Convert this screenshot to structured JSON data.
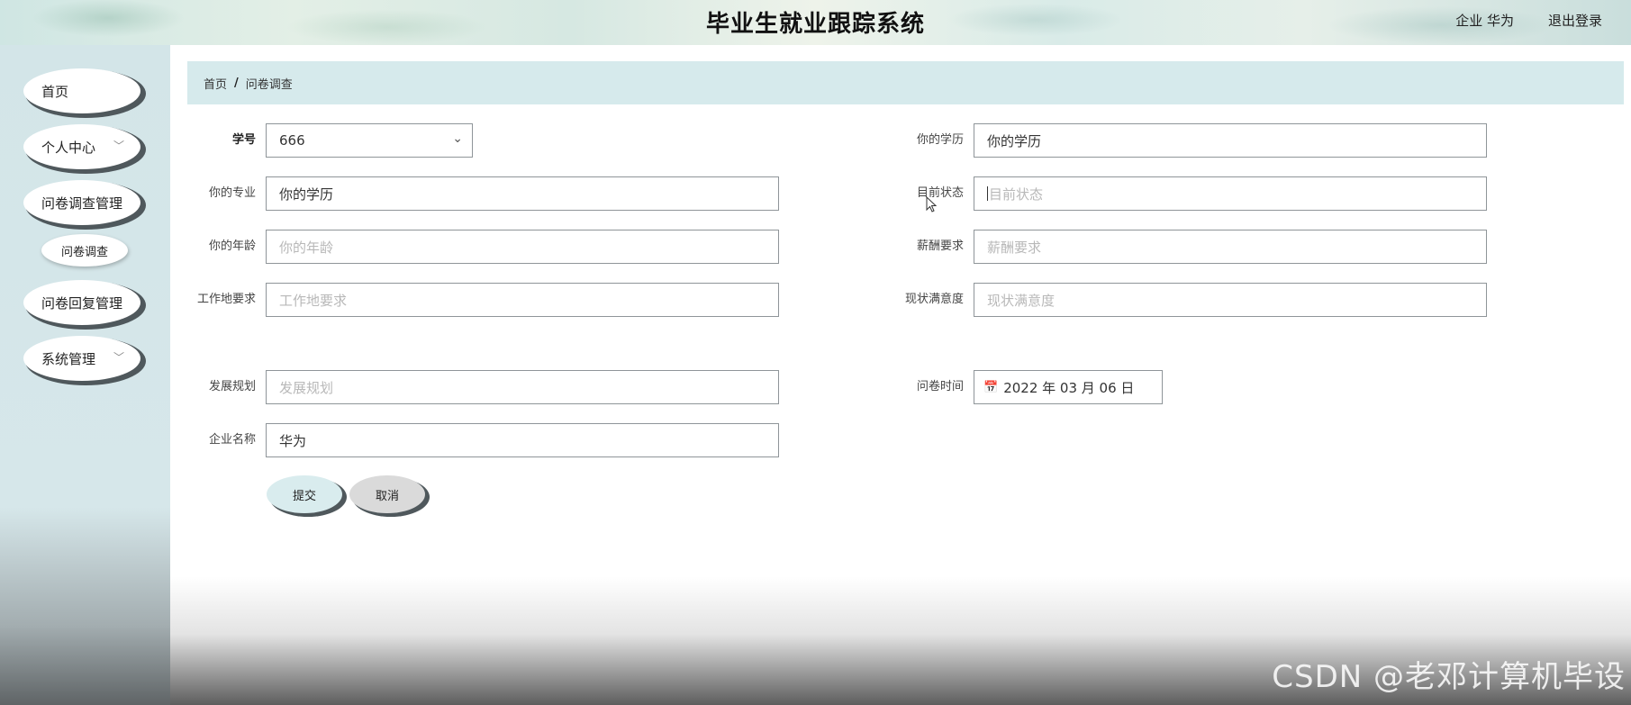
{
  "header": {
    "title": "毕业生就业跟踪系统",
    "user": "企业 华为",
    "logout": "退出登录"
  },
  "sidebar": {
    "items": [
      {
        "label": "首页"
      },
      {
        "label": "个人中心",
        "chevron": "﹀"
      },
      {
        "label": "问卷调查管理"
      },
      {
        "label": "问卷调查"
      },
      {
        "label": "问卷回复管理"
      },
      {
        "label": "系统管理",
        "chevron": "﹀"
      }
    ]
  },
  "breadcrumb": {
    "home": "首页",
    "separator": "/",
    "current": "问卷调查"
  },
  "form": {
    "student_id": {
      "label": "学号",
      "value": "666"
    },
    "major": {
      "label": "你的专业",
      "value": "你的学历"
    },
    "age": {
      "label": "你的年龄",
      "placeholder": "你的年龄"
    },
    "work_location": {
      "label": "工作地要求",
      "placeholder": "工作地要求"
    },
    "development": {
      "label": "发展规划",
      "placeholder": "发展规划"
    },
    "company": {
      "label": "企业名称",
      "value": "华为"
    },
    "education": {
      "label": "你的学历",
      "value": "你的学历"
    },
    "status": {
      "label": "目前状态",
      "placeholder": "目前状态"
    },
    "salary": {
      "label": "薪酬要求",
      "placeholder": "薪酬要求"
    },
    "satisfaction": {
      "label": "现状满意度",
      "placeholder": "现状满意度"
    },
    "survey_time": {
      "label": "问卷时间",
      "value": "2022 年 03 月 06 日"
    }
  },
  "buttons": {
    "submit": "提交",
    "cancel": "取消"
  },
  "watermark": "CSDN @老邓计算机毕设",
  "icons": {
    "dropdown": "chevron-down-icon",
    "calendar": "calendar-icon"
  }
}
